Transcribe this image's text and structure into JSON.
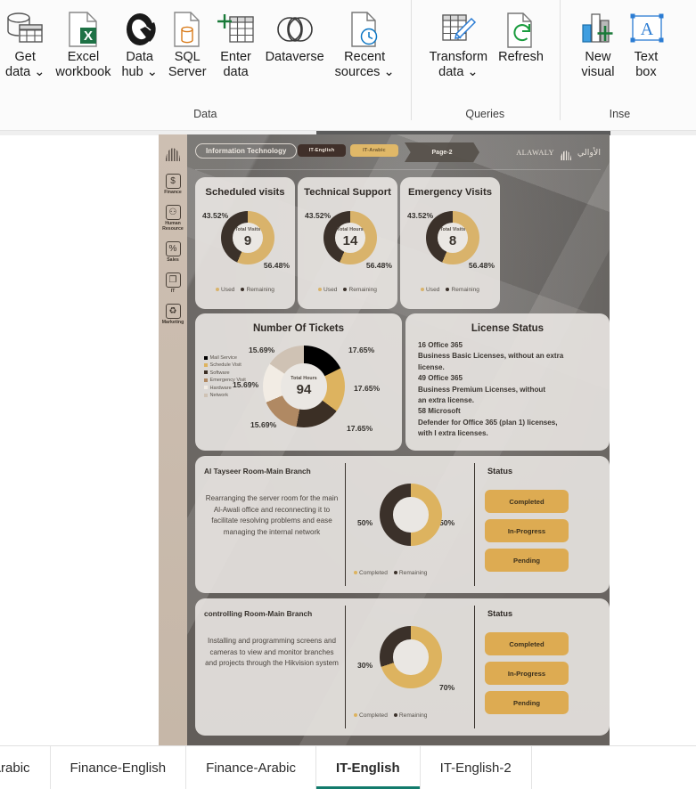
{
  "ribbon": {
    "groups": [
      {
        "label": "Data",
        "buttons": [
          {
            "name": "get-data",
            "label": "Get\ndata",
            "icon": "database-table-icon",
            "dropdown": true
          },
          {
            "name": "excel-workbook",
            "label": "Excel\nworkbook",
            "icon": "excel-file-icon",
            "dropdown": false
          },
          {
            "name": "data-hub",
            "label": "Data\nhub",
            "icon": "datahub-icon",
            "dropdown": true
          },
          {
            "name": "sql-server",
            "label": "SQL\nServer",
            "icon": "sql-server-icon",
            "dropdown": false
          },
          {
            "name": "enter-data",
            "label": "Enter\ndata",
            "icon": "enter-data-icon",
            "dropdown": false
          },
          {
            "name": "dataverse",
            "label": "Dataverse",
            "icon": "dataverse-icon",
            "dropdown": false
          },
          {
            "name": "recent-sources",
            "label": "Recent\nsources",
            "icon": "recent-sources-icon",
            "dropdown": true
          }
        ]
      },
      {
        "label": "Queries",
        "buttons": [
          {
            "name": "transform-data",
            "label": "Transform\ndata",
            "icon": "transform-data-icon",
            "dropdown": true
          },
          {
            "name": "refresh",
            "label": "Refresh",
            "icon": "refresh-icon",
            "dropdown": false
          }
        ]
      },
      {
        "label": "Inse",
        "buttons": [
          {
            "name": "new-visual",
            "label": "New\nvisual",
            "icon": "new-visual-icon",
            "dropdown": false
          },
          {
            "name": "text-box",
            "label": "Text\nbox",
            "icon": "text-box-icon",
            "dropdown": false
          }
        ]
      }
    ]
  },
  "report": {
    "sidebar": {
      "logo": "alawaly-mark-icon",
      "items": [
        {
          "label": "Finance",
          "icon": "dollar-icon",
          "glyph": "$"
        },
        {
          "label": "Human\nResource",
          "icon": "people-icon",
          "glyph": "⚇"
        },
        {
          "label": "Sales",
          "icon": "percent-icon",
          "glyph": "%"
        },
        {
          "label": "IT",
          "icon": "monitor-icon",
          "glyph": "❐"
        },
        {
          "label": "Marketing",
          "icon": "recycle-icon",
          "glyph": "♻"
        }
      ]
    },
    "header": {
      "title_pill": "Information Technology",
      "lang_en_button": "IT-English",
      "lang_ar_button": "IT-Arabic",
      "page_chip": "Page-2",
      "brand_en": "ALAWALY",
      "brand_ar": "الأوالي"
    },
    "kpi_cards": [
      {
        "title": "Scheduled visits",
        "center_caption": "Total Visits",
        "center_value": "9",
        "left_pct": "43.52%",
        "right_pct": "56.48%",
        "legend": [
          "Used",
          "Remaining"
        ]
      },
      {
        "title": "Technical Support",
        "center_caption": "Total Hours",
        "center_value": "14",
        "left_pct": "43.52%",
        "right_pct": "56.48%",
        "legend": [
          "Used",
          "Remaining"
        ]
      },
      {
        "title": "Emergency Visits",
        "center_caption": "Total Visits",
        "center_value": "8",
        "left_pct": "43.52%",
        "right_pct": "56.48%",
        "legend": [
          "Used",
          "Remaining"
        ]
      }
    ],
    "tickets": {
      "title": "Number Of Tickets",
      "center_caption": "Total Hours",
      "center_value": "94",
      "legend": [
        "Mail Service",
        "Schedule Visit",
        "Software",
        "Emergency Visit",
        "Hardware",
        "Network"
      ],
      "labels": {
        "top_left": "15.69%",
        "top_right": "17.65%",
        "mid_left": "15.69%",
        "mid_right": "17.65%",
        "bottom_left": "15.69%",
        "bottom_right": "17.65%"
      }
    },
    "license": {
      "title": "License Status",
      "body": "16 Office 365\nBusiness Basic Licenses, without an extra\nlicense.\n49 Office 365\nBusiness Premium Licenses, without\nan extra license.\n58 Microsoft\nDefender for Office 365 (plan 1) licenses,\nwith I extra licenses."
    },
    "projects": [
      {
        "name": "Al Tayseer Room-Main Branch",
        "description": "Rearranging the server room for the main Al-Awali office and reconnecting it to facilitate resolving problems and ease managing the internal network",
        "left_pct": "50%",
        "right_pct": "50%",
        "legend": [
          "Completed",
          "Remaining"
        ],
        "status_title": "Status",
        "status_buttons": [
          "Completed",
          "In-Progress",
          "Pending"
        ]
      },
      {
        "name": "controlling Room-Main Branch",
        "description": "Installing and programming screens and cameras to view and monitor branches and projects through the Hikvision system",
        "left_pct": "30%",
        "right_pct": "70%",
        "legend": [
          "Completed",
          "Remaining"
        ],
        "status_title": "Status",
        "status_buttons": [
          "Completed",
          "In-Progress",
          "Pending"
        ]
      }
    ]
  },
  "tabs": [
    {
      "label": "ing-Arabic",
      "active": false,
      "clipped": true
    },
    {
      "label": "Finance-English",
      "active": false,
      "clipped": false
    },
    {
      "label": "Finance-Arabic",
      "active": false,
      "clipped": false
    },
    {
      "label": "IT-English",
      "active": true,
      "clipped": false
    },
    {
      "label": "IT-English-2",
      "active": false,
      "clipped": false
    }
  ],
  "chart_data": [
    {
      "type": "pie",
      "title": "Scheduled visits",
      "labels": [
        "Used",
        "Remaining"
      ],
      "values": [
        56.48,
        43.52
      ],
      "unit": "%",
      "center_label": "Total Visits",
      "center_value": 9,
      "colors": [
        "#d9b36b",
        "#3b312a"
      ],
      "legend_position": "bottom"
    },
    {
      "type": "pie",
      "title": "Technical Support",
      "labels": [
        "Used",
        "Remaining"
      ],
      "values": [
        56.48,
        43.52
      ],
      "unit": "%",
      "center_label": "Total Hours",
      "center_value": 14,
      "colors": [
        "#d9b36b",
        "#3b312a"
      ],
      "legend_position": "bottom"
    },
    {
      "type": "pie",
      "title": "Emergency Visits",
      "labels": [
        "Used",
        "Remaining"
      ],
      "values": [
        56.48,
        43.52
      ],
      "unit": "%",
      "center_label": "Total Visits",
      "center_value": 8,
      "colors": [
        "#d9b36b",
        "#3b312a"
      ],
      "legend_position": "bottom"
    },
    {
      "type": "pie",
      "title": "Number Of Tickets",
      "labels": [
        "Mail Service",
        "Schedule Visit",
        "Software",
        "Emergency Visit",
        "Hardware",
        "Network"
      ],
      "values": [
        17.65,
        17.65,
        17.65,
        15.69,
        15.69,
        15.69
      ],
      "unit": "%",
      "center_label": "Total Hours",
      "center_value": 94,
      "colors": [
        "#000000",
        "#ddb35f",
        "#3b2f25",
        "#b08963",
        "#f2ece4",
        "#cfc2b4"
      ],
      "legend_position": "left"
    },
    {
      "type": "pie",
      "title": "Al Tayseer Room-Main Branch",
      "labels": [
        "Completed",
        "Remaining"
      ],
      "values": [
        50,
        50
      ],
      "unit": "%",
      "colors": [
        "#ddb35f",
        "#3b312a"
      ],
      "legend_position": "bottom"
    },
    {
      "type": "pie",
      "title": "controlling Room-Main Branch",
      "labels": [
        "Completed",
        "Remaining"
      ],
      "values": [
        70,
        30
      ],
      "unit": "%",
      "colors": [
        "#ddb35f",
        "#3b312a"
      ],
      "legend_position": "bottom"
    }
  ]
}
